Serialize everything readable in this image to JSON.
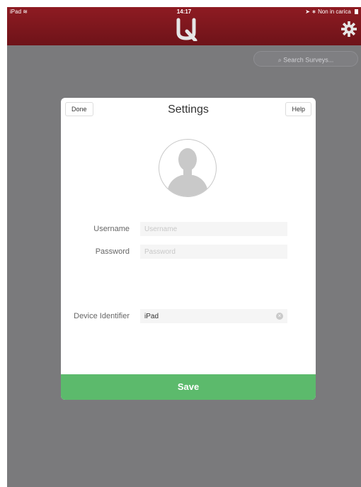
{
  "status_bar": {
    "device": "iPad",
    "wifi_symbol": "≋",
    "time": "14:17",
    "right_text": "Non in carica",
    "location_symbol": "➤",
    "bluetooth_symbol": "∗"
  },
  "header": {
    "logo_icon": "q-logo-icon",
    "settings_icon": "gear-icon",
    "brand_color": "#7e171d"
  },
  "search": {
    "placeholder": "Search Surveys..."
  },
  "settings_modal": {
    "title": "Settings",
    "done_label": "Done",
    "help_label": "Help",
    "avatar_icon": "user-avatar-icon",
    "fields": {
      "username": {
        "label": "Username",
        "placeholder": "Username",
        "value": ""
      },
      "password": {
        "label": "Password",
        "placeholder": "Password",
        "value": ""
      },
      "device_identifier": {
        "label": "Device Identifier",
        "value": "iPad"
      }
    },
    "save_label": "Save",
    "save_color": "#5cba6c"
  }
}
